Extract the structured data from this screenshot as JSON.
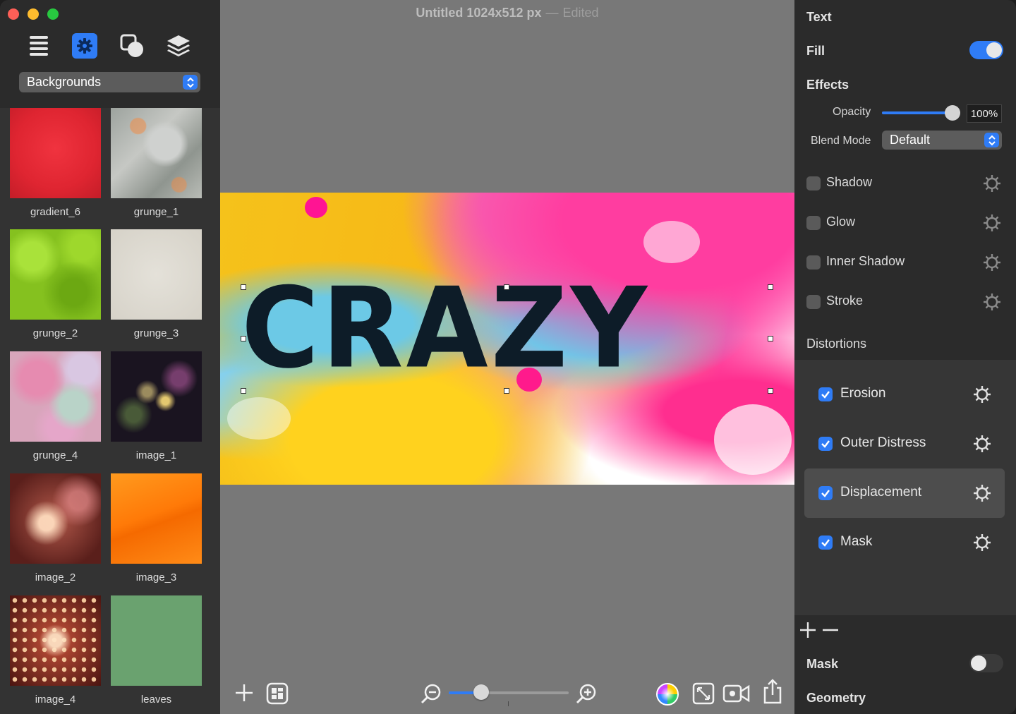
{
  "window": {
    "title": "Untitled 1024x512 px",
    "separator": "—",
    "status": "Edited"
  },
  "sidebar": {
    "tools": [
      {
        "icon": "list-icon"
      },
      {
        "icon": "gear-icon",
        "selected": true
      },
      {
        "icon": "shapes-icon"
      },
      {
        "icon": "layers-icon"
      }
    ],
    "category": "Backgrounds",
    "items": [
      {
        "label": "gradient_6"
      },
      {
        "label": "grunge_1"
      },
      {
        "label": "grunge_2"
      },
      {
        "label": "grunge_3"
      },
      {
        "label": "grunge_4"
      },
      {
        "label": "image_1"
      },
      {
        "label": "image_2"
      },
      {
        "label": "image_3"
      },
      {
        "label": "image_4"
      },
      {
        "label": "leaves"
      }
    ]
  },
  "canvas": {
    "text": "CRAZY"
  },
  "toolbar": {
    "zoom_level": 0.27
  },
  "inspector": {
    "text_heading": "Text",
    "fill_label": "Fill",
    "fill_on": true,
    "effects_heading": "Effects",
    "opacity_label": "Opacity",
    "opacity_value": "100%",
    "opacity_fraction": 1.0,
    "blend_label": "Blend Mode",
    "blend_value": "Default",
    "effects": [
      {
        "label": "Shadow",
        "checked": false
      },
      {
        "label": "Glow",
        "checked": false
      },
      {
        "label": "Inner Shadow",
        "checked": false
      },
      {
        "label": "Stroke",
        "checked": false
      }
    ],
    "distortions_heading": "Distortions",
    "distortions": [
      {
        "label": "Erosion",
        "checked": true
      },
      {
        "label": "Outer Distress",
        "checked": true
      },
      {
        "label": "Displacement",
        "checked": true,
        "selected": true
      },
      {
        "label": "Mask",
        "checked": true
      }
    ],
    "mask_label": "Mask",
    "mask_on": false,
    "geometry_heading": "Geometry"
  },
  "colors": {
    "accent": "#2f7cf6",
    "sidebar_bg": "#2b2b2b",
    "canvas_bg": "#787878"
  }
}
